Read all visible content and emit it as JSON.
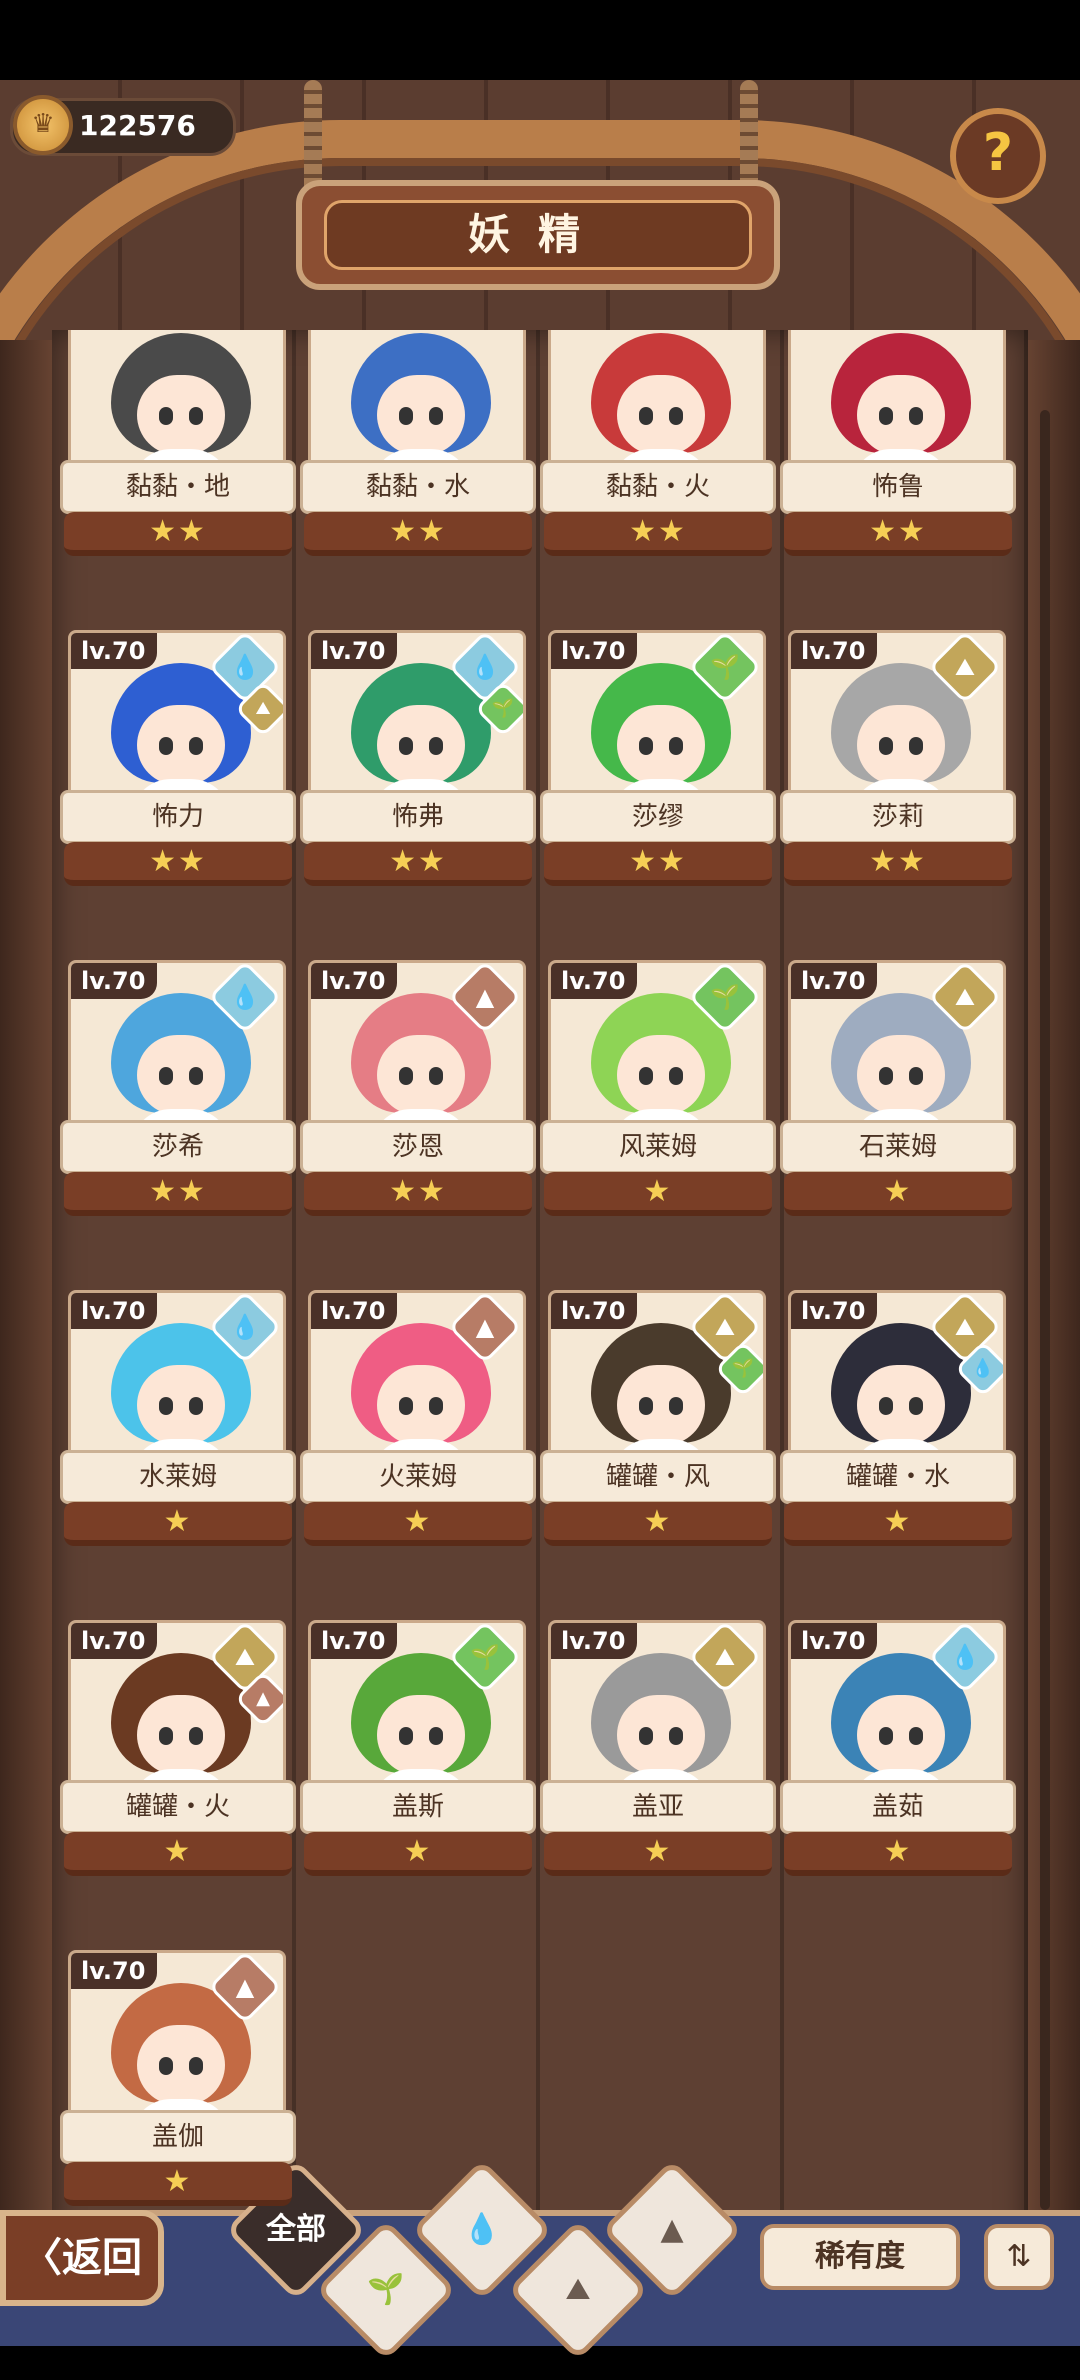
{
  "currency": {
    "value": "122576",
    "icon": "crown-coin-icon"
  },
  "header": {
    "title": "妖精",
    "help_label": "?"
  },
  "cards": [
    {
      "name": "黏黏・地",
      "level": "",
      "stars": "★★",
      "hair": "#4a4a4a",
      "elements": []
    },
    {
      "name": "黏黏・水",
      "level": "",
      "stars": "★★",
      "hair": "#3d6fc4",
      "elements": []
    },
    {
      "name": "黏黏・火",
      "level": "",
      "stars": "★★",
      "hair": "#c83a3a",
      "elements": []
    },
    {
      "name": "怖鲁",
      "level": "",
      "stars": "★★",
      "hair": "#b8243c",
      "elements": []
    },
    {
      "name": "怖力",
      "level": "lv.70",
      "stars": "★★",
      "hair": "#2e5fd2",
      "elements": [
        "water",
        "earth"
      ]
    },
    {
      "name": "怖弗",
      "level": "lv.70",
      "stars": "★★",
      "hair": "#2f9c6a",
      "elements": [
        "water",
        "wind"
      ]
    },
    {
      "name": "莎缪",
      "level": "lv.70",
      "stars": "★★",
      "hair": "#45b84a",
      "elements": [
        "wind"
      ]
    },
    {
      "name": "莎莉",
      "level": "lv.70",
      "stars": "★★",
      "hair": "#a7a7a7",
      "elements": [
        "earth"
      ]
    },
    {
      "name": "莎希",
      "level": "lv.70",
      "stars": "★★",
      "hair": "#4ea6dd",
      "elements": [
        "water"
      ]
    },
    {
      "name": "莎恩",
      "level": "lv.70",
      "stars": "★★",
      "hair": "#e57d85",
      "elements": [
        "fire"
      ]
    },
    {
      "name": "风莱姆",
      "level": "lv.70",
      "stars": "★",
      "hair": "#8ed455",
      "elements": [
        "wind"
      ]
    },
    {
      "name": "石莱姆",
      "level": "lv.70",
      "stars": "★",
      "hair": "#9eacc0",
      "elements": [
        "earth"
      ]
    },
    {
      "name": "水莱姆",
      "level": "lv.70",
      "stars": "★",
      "hair": "#4cc3ea",
      "elements": [
        "water"
      ]
    },
    {
      "name": "火莱姆",
      "level": "lv.70",
      "stars": "★",
      "hair": "#ef5d84",
      "elements": [
        "fire"
      ]
    },
    {
      "name": "罐罐・风",
      "level": "lv.70",
      "stars": "★",
      "hair": "#4a3b2c",
      "elements": [
        "earth",
        "wind"
      ]
    },
    {
      "name": "罐罐・水",
      "level": "lv.70",
      "stars": "★",
      "hair": "#2d2d3a",
      "elements": [
        "earth",
        "water"
      ]
    },
    {
      "name": "罐罐・火",
      "level": "lv.70",
      "stars": "★",
      "hair": "#6b3a22",
      "elements": [
        "earth",
        "fire"
      ]
    },
    {
      "name": "盖斯",
      "level": "lv.70",
      "stars": "★",
      "hair": "#58a83a",
      "elements": [
        "wind"
      ]
    },
    {
      "name": "盖亚",
      "level": "lv.70",
      "stars": "★",
      "hair": "#9a9a9a",
      "elements": [
        "earth"
      ]
    },
    {
      "name": "盖茹",
      "level": "lv.70",
      "stars": "★",
      "hair": "#3b83b6",
      "elements": [
        "water"
      ]
    },
    {
      "name": "盖伽",
      "level": "lv.70",
      "stars": "★",
      "hair": "#c36a44",
      "elements": [
        "fire"
      ]
    }
  ],
  "element_icons": {
    "water": "💧",
    "earth": "⛰",
    "wind": "🌱",
    "fire": "▲"
  },
  "bottom": {
    "back_label": "〈返回",
    "filter_all_label": "全部",
    "filters": [
      "wind-sprout-icon",
      "water-drop-icon",
      "earth-mountain-icon",
      "fire-mountain-icon"
    ],
    "sort_label": "稀有度",
    "order_label": "⇅"
  }
}
